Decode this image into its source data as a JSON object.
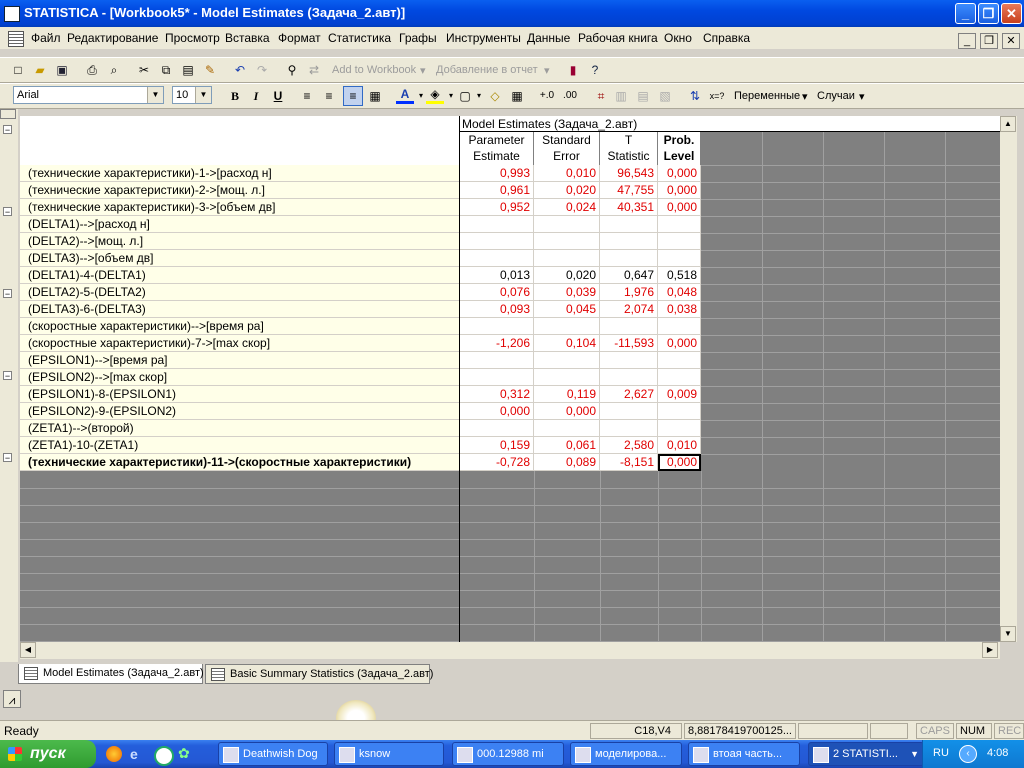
{
  "window": {
    "title": "STATISTICA - [Workbook5* - Model Estimates (Задача_2.авт)]",
    "min": "_",
    "max": "❐",
    "close": "✕"
  },
  "menu": [
    "Файл",
    "Редактирование",
    "Просмотр",
    "Вставка",
    "Формат",
    "Статистика",
    "Графы",
    "Инструменты",
    "Данные",
    "Рабочая книга",
    "Окно",
    "Справка"
  ],
  "toolbar1": {
    "add_to_workbook": "Add to Workbook",
    "add_to_report": "Добавление в отчет"
  },
  "toolbar2": {
    "font": "Arial",
    "size": "10",
    "bold": "B",
    "italic": "I",
    "underline": "U",
    "variables": "Переменные",
    "cases": "Случаи"
  },
  "spreadsheet": {
    "title": "Model Estimates (Задача_2.авт)",
    "columns": [
      {
        "l1": "Parameter",
        "l2": "Estimate"
      },
      {
        "l1": "Standard",
        "l2": "Error"
      },
      {
        "l1": "T",
        "l2": "Statistic"
      },
      {
        "l1": "Prob.",
        "l2": "Level"
      }
    ],
    "rows": [
      {
        "label": "(технические характеристики)-1->[расход н]",
        "v": [
          "0,993",
          "0,010",
          "96,543",
          "0,000"
        ],
        "red": true
      },
      {
        "label": "(технические характеристики)-2->[мощ.  л.]",
        "v": [
          "0,961",
          "0,020",
          "47,755",
          "0,000"
        ],
        "red": true
      },
      {
        "label": "(технические характеристики)-3->[объем дв]",
        "v": [
          "0,952",
          "0,024",
          "40,351",
          "0,000"
        ],
        "red": true
      },
      {
        "label": "(DELTA1)-->[расход н]",
        "v": [
          "",
          "",
          "",
          ""
        ],
        "red": false
      },
      {
        "label": "(DELTA2)-->[мощ.  л.]",
        "v": [
          "",
          "",
          "",
          ""
        ],
        "red": false
      },
      {
        "label": "(DELTA3)-->[объем дв]",
        "v": [
          "",
          "",
          "",
          ""
        ],
        "red": false
      },
      {
        "label": "(DELTA1)-4-(DELTA1)",
        "v": [
          "0,013",
          "0,020",
          "0,647",
          "0,518"
        ],
        "red": false
      },
      {
        "label": "(DELTA2)-5-(DELTA2)",
        "v": [
          "0,076",
          "0,039",
          "1,976",
          "0,048"
        ],
        "red": true
      },
      {
        "label": "(DELTA3)-6-(DELTA3)",
        "v": [
          "0,093",
          "0,045",
          "2,074",
          "0,038"
        ],
        "red": true
      },
      {
        "label": "(скоростные характеристики)-->[время ра]",
        "v": [
          "",
          "",
          "",
          ""
        ],
        "red": false
      },
      {
        "label": "(скоростные характеристики)-7->[max скор]",
        "v": [
          "-1,206",
          "0,104",
          "-11,593",
          "0,000"
        ],
        "red": true
      },
      {
        "label": "(EPSILON1)-->[время ра]",
        "v": [
          "",
          "",
          "",
          ""
        ],
        "red": false
      },
      {
        "label": "(EPSILON2)-->[max скор]",
        "v": [
          "",
          "",
          "",
          ""
        ],
        "red": false
      },
      {
        "label": "(EPSILON1)-8-(EPSILON1)",
        "v": [
          "0,312",
          "0,119",
          "2,627",
          "0,009"
        ],
        "red": true
      },
      {
        "label": "(EPSILON2)-9-(EPSILON2)",
        "v": [
          "0,000",
          "0,000",
          "",
          ""
        ],
        "red": true
      },
      {
        "label": "(ZETA1)-->(второй)",
        "v": [
          "",
          "",
          "",
          ""
        ],
        "red": false
      },
      {
        "label": "(ZETA1)-10-(ZETA1)",
        "v": [
          "0,159",
          "0,061",
          "2,580",
          "0,010"
        ],
        "red": true
      },
      {
        "label": "(технические характеристики)-11->(скоростные характеристики)",
        "v": [
          "-0,728",
          "0,089",
          "-8,151",
          "0,000"
        ],
        "red": true,
        "bold": true
      }
    ]
  },
  "sheet_tabs": [
    "Model Estimates (Задача_2.авт)",
    "Basic Summary Statistics (Задача_2.авт)"
  ],
  "status": {
    "ready": "Ready",
    "cell": "C18,V4",
    "value": "8,88178419700125...",
    "caps": "CAPS",
    "num": "NUM",
    "rec": "REC"
  },
  "taskbar": {
    "start": "пуск",
    "tasks": [
      "Deathwish Dog",
      "ksnow",
      "000.12988 mi",
      "моделирова...",
      "втоая часть...",
      "2 STATISTI..."
    ],
    "lang": "RU",
    "clock": "4:08"
  }
}
